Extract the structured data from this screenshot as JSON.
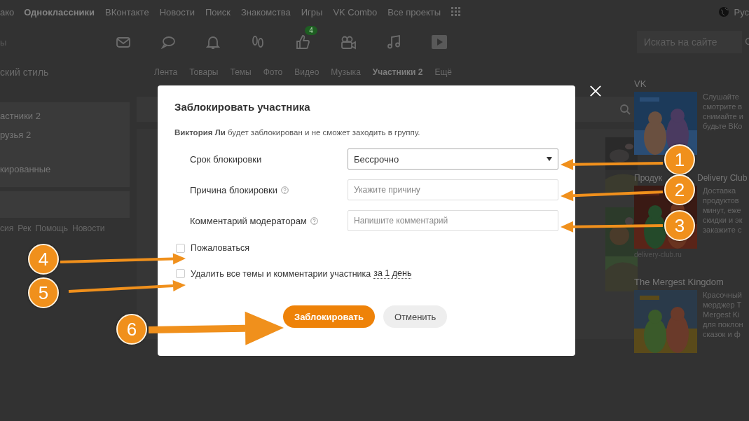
{
  "top_nav": {
    "items": [
      {
        "label": "ако",
        "selected": false
      },
      {
        "label": "Одноклассники",
        "selected": true
      },
      {
        "label": "ВКонтакте",
        "selected": false
      },
      {
        "label": "Новости",
        "selected": false
      },
      {
        "label": "Поиск",
        "selected": false
      },
      {
        "label": "Знакомства",
        "selected": false
      },
      {
        "label": "Игры",
        "selected": false
      },
      {
        "label": "VK Combo",
        "selected": false
      },
      {
        "label": "Все проекты",
        "selected": false
      }
    ],
    "language": "Рус"
  },
  "icon_bar": {
    "left_text": "ы",
    "likes_badge": "4",
    "search": {
      "placeholder": "Искать на сайте"
    }
  },
  "left_column": {
    "group_title": "ский стиль",
    "menu": [
      {
        "label": "астники 2"
      },
      {
        "label": "рузья 2"
      },
      {
        "label": "кированные"
      }
    ],
    "footer_links": [
      "сия",
      "Рек",
      "Помощь",
      "Новости"
    ]
  },
  "group_tabs": [
    {
      "label": "Лента",
      "selected": false
    },
    {
      "label": "Товары",
      "selected": false
    },
    {
      "label": "Темы",
      "selected": false
    },
    {
      "label": "Фото",
      "selected": false
    },
    {
      "label": "Видео",
      "selected": false
    },
    {
      "label": "Музыка",
      "selected": false
    },
    {
      "label": "Участники 2",
      "selected": true
    },
    {
      "label": "Ещё",
      "selected": false
    }
  ],
  "right_column": {
    "ads": [
      {
        "title": "VK",
        "lines": [
          "Слушайте",
          "смотрите в",
          "снимайте и",
          "будьте ВКо"
        ]
      },
      {
        "title_parts": [
          "Продук",
          "Delivery Club"
        ],
        "lines": [
          "Доставка",
          "продуктов",
          "минут, еже",
          "скидки и эк",
          "закажите с"
        ],
        "domain": "delivery-club.ru"
      },
      {
        "title": "The Mergest Kingdom",
        "lines": [
          "Красочный",
          "мерджер Т",
          "Mergest Ki",
          "для поклон",
          "сказок и ф"
        ]
      }
    ]
  },
  "modal": {
    "title": "Заблокировать участника",
    "description": "**Виктория Ли** будет заблокирован и не сможет заходить в группу.",
    "fields": [
      {
        "kind": "select",
        "label": "Срок блокировки",
        "value": "Бессрочно",
        "help": false
      },
      {
        "kind": "input",
        "label": "Причина блокировки",
        "placeholder": "Укажите причину",
        "help": true
      },
      {
        "kind": "input",
        "label": "Комментарий модераторам",
        "placeholder": "Напишите комментарий",
        "help": true
      }
    ],
    "checkboxes": [
      {
        "label": "Пожаловаться",
        "checked": false
      },
      {
        "label": "Удалить все темы и комментарии участника",
        "link": "за 1 день",
        "checked": false
      }
    ],
    "buttons": [
      {
        "label": "Заблокировать",
        "kind": "primary"
      },
      {
        "label": "Отменить",
        "kind": "secondary"
      }
    ]
  },
  "annotations": [
    {
      "number": "1"
    },
    {
      "number": "2"
    },
    {
      "number": "3"
    },
    {
      "number": "4"
    },
    {
      "number": "5"
    },
    {
      "number": "6"
    }
  ]
}
